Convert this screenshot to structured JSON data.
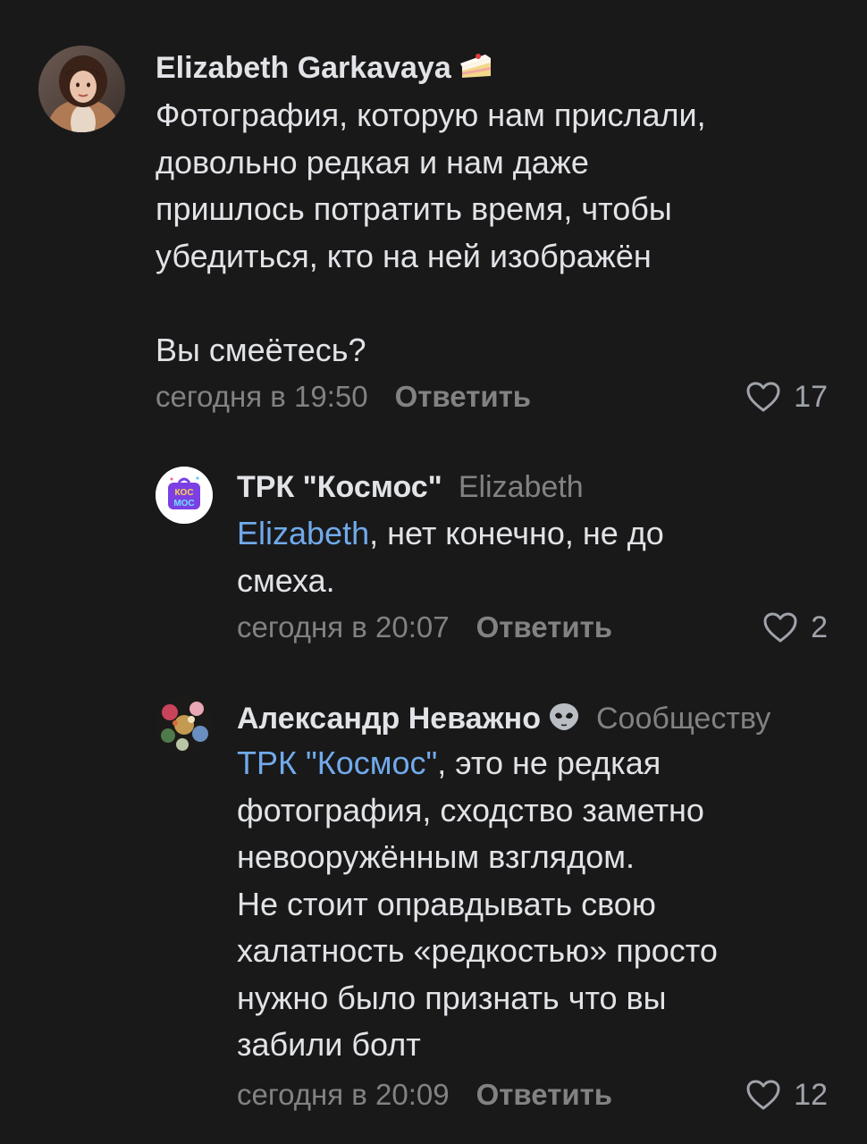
{
  "comments": [
    {
      "author": "Elizabeth Garkavaya",
      "author_emoji": "cake-icon",
      "text": "Фотография, которую нам прислали,\nдовольно редкая и нам даже\nпришлось потратить время, чтобы\nубедиться, кто на ней изображён\n\nВы смеётесь?",
      "time": "сегодня в 19:50",
      "reply_label": "Ответить",
      "likes": "17"
    },
    {
      "author": "ТРК \"Космос\"",
      "reply_to": "Elizabeth",
      "avatar_logo_text": "КОС МОС",
      "mention": "Elizabeth",
      "text": ", нет конечно, не до\nсмеха.",
      "time": "сегодня в 20:07",
      "reply_label": "Ответить",
      "likes": "2"
    },
    {
      "author": "Александр Неважно",
      "author_emoji": "alien-icon",
      "reply_to": "Сообществу",
      "mention": "ТРК \"Космос\"",
      "text": ", это не редкая\nфотография, сходство заметно\nневооружённым взглядом.\nНе стоит оправдывать свою\nхалатность «редкостью» просто\nнужно было признать что вы\nзабили болт",
      "time": "сегодня в 20:09",
      "reply_label": "Ответить",
      "likes": "12"
    }
  ],
  "colors": {
    "background": "#19191a",
    "text": "#e1e3e6",
    "secondary": "#828282",
    "link": "#71aaeb"
  }
}
